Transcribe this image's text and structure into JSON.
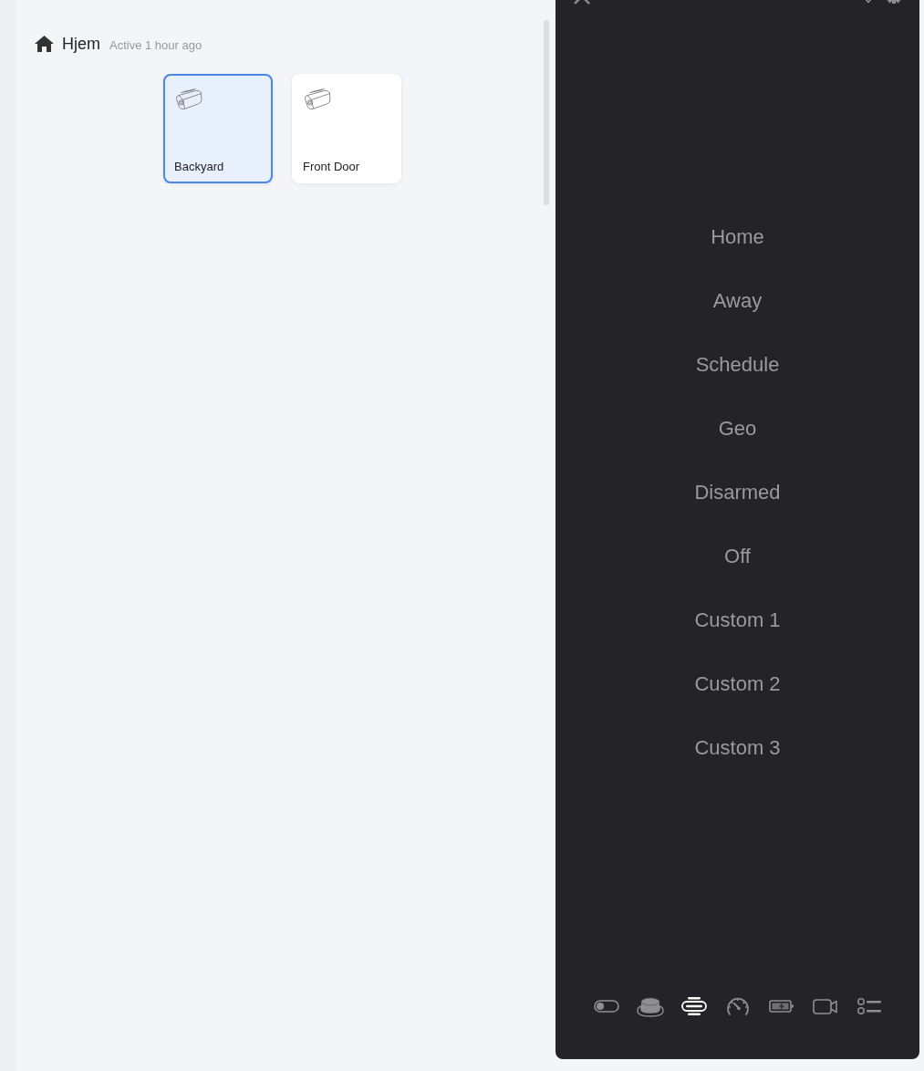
{
  "header": {
    "title": "Hjem",
    "status": "Active 1 hour ago"
  },
  "devices": [
    {
      "name": "Backyard",
      "selected": true
    },
    {
      "name": "Front Door",
      "selected": false
    }
  ],
  "mode_panel": {
    "modes": [
      {
        "label": "Home",
        "selected": false
      },
      {
        "label": "Away",
        "selected": false
      },
      {
        "label": "Schedule",
        "selected": false
      },
      {
        "label": "Geo",
        "selected": false
      },
      {
        "label": "Disarmed",
        "selected": false
      },
      {
        "label": "Off",
        "selected": false
      },
      {
        "label": "Custom 1",
        "selected": false
      },
      {
        "label": "Custom 2",
        "selected": false
      },
      {
        "label": "Custom 3",
        "selected": false
      }
    ],
    "toolbar": [
      {
        "kind": "toggle",
        "selected": false
      },
      {
        "kind": "button",
        "selected": false
      },
      {
        "kind": "port",
        "selected": true
      },
      {
        "kind": "gauge",
        "selected": false
      },
      {
        "kind": "battery",
        "selected": false
      },
      {
        "kind": "video",
        "selected": false
      },
      {
        "kind": "list",
        "selected": false
      }
    ]
  }
}
